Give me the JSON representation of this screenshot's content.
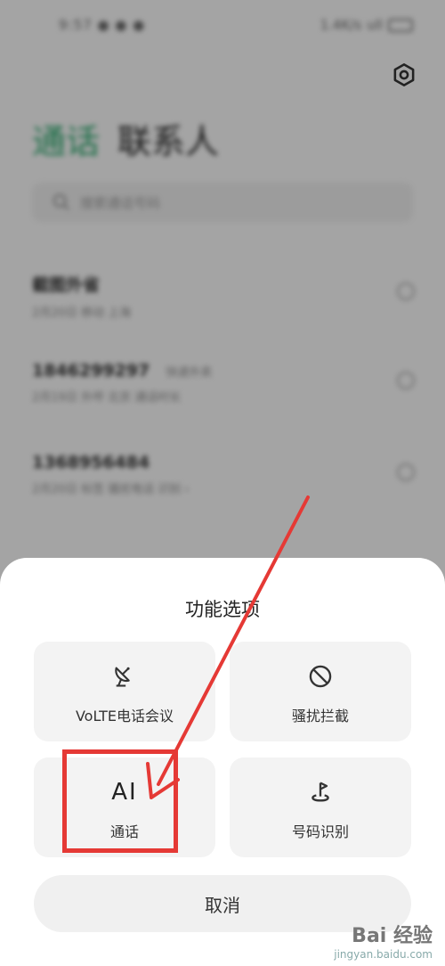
{
  "status_bar": {
    "time": "9:57 ● ● ●",
    "network": "1.4K/s",
    "signal": "ull"
  },
  "header": {
    "tab_call": "通话",
    "tab_contacts": "联系人"
  },
  "search": {
    "placeholder": "搜索通话号码"
  },
  "calls": [
    {
      "name": "截图外省",
      "tag": "",
      "sub": "2月20日 移动 上海"
    },
    {
      "name": "1846299297",
      "tag": "快递外卖",
      "sub": "2月19日 外呼 北京 通话时长"
    },
    {
      "name": "1368956484",
      "tag": "",
      "sub": "2月20日 标签 骚扰电话 识别 ›"
    }
  ],
  "sheet": {
    "title": "功能选项",
    "tiles": [
      {
        "icon": "satellite-dish-icon",
        "label": "VoLTE电话会议"
      },
      {
        "icon": "block-icon",
        "label": "骚扰拦截"
      },
      {
        "icon": "ai-text-icon",
        "glyph": "AI",
        "label": "通话"
      },
      {
        "icon": "number-recognition-icon",
        "label": "号码识别"
      }
    ],
    "cancel_label": "取消"
  },
  "colors": {
    "accent_green": "#2aa46a",
    "highlight_red": "#e53935"
  },
  "watermark": {
    "main": "Bai 经验",
    "sub": "jingyan.baidu.com"
  }
}
